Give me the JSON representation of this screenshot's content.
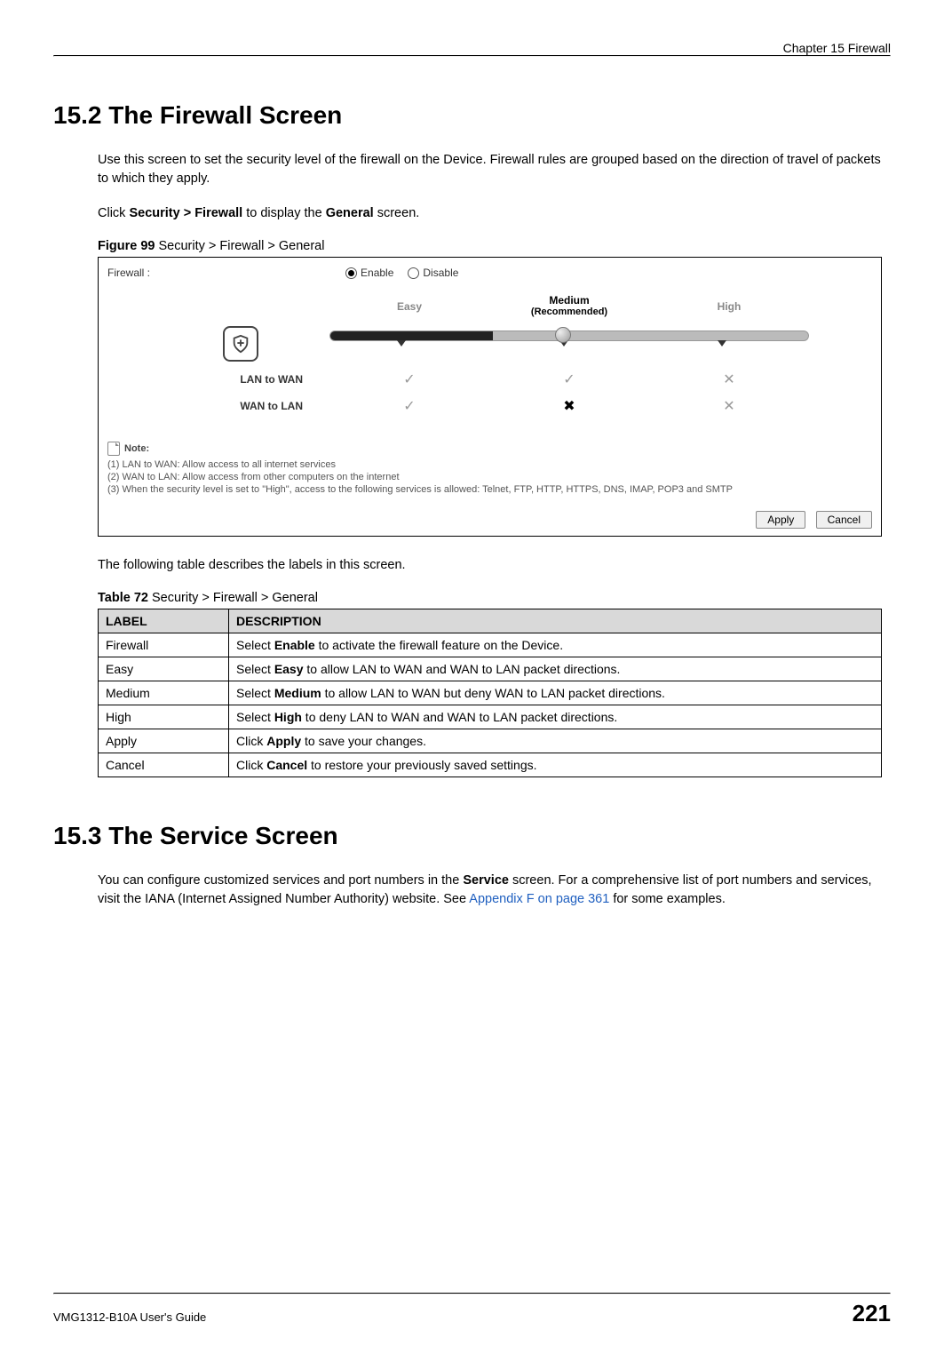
{
  "header": {
    "chapter": "Chapter 15 Firewall"
  },
  "section_15_2": {
    "title": "15.2  The Firewall Screen",
    "para1": "Use this screen to set the security level of the firewall on the Device. Firewall rules are grouped based on the direction of travel of packets to which they apply.",
    "para2_pre": "Click ",
    "para2_bold1": "Security > Firewall",
    "para2_mid": " to display the ",
    "para2_bold2": "General",
    "para2_post": " screen.",
    "figure_caption_strong": "Figure 99",
    "figure_caption_rest": "   Security > Firewall > General",
    "after_figure": "The following table describes the labels in this screen.",
    "table_caption_strong": "Table 72",
    "table_caption_rest": "   Security > Firewall > General"
  },
  "figure": {
    "firewall_label": "Firewall :",
    "enable": "Enable",
    "disable": "Disable",
    "easy": "Easy",
    "medium": "Medium",
    "recommended": "(Recommended)",
    "high": "High",
    "lan_to_wan": "LAN to WAN",
    "wan_to_lan": "WAN to LAN",
    "note_title": "Note:",
    "note1": "(1) LAN to WAN: Allow access to all internet services",
    "note2": "(2) WAN to LAN: Allow access from other computers on the internet",
    "note3": "(3) When the security level is set to \"High\", access to the following services is allowed: Telnet, FTP, HTTP, HTTPS, DNS, IMAP, POP3 and SMTP",
    "apply_btn": "Apply",
    "cancel_btn": "Cancel"
  },
  "table72": {
    "head_label": "LABEL",
    "head_desc": "DESCRIPTION",
    "rows": [
      {
        "label": "Firewall",
        "pre": "Select ",
        "bold": "Enable",
        "post": " to activate the firewall feature on the Device."
      },
      {
        "label": "Easy",
        "pre": "Select ",
        "bold": "Easy",
        "post": " to allow LAN to WAN and WAN to LAN packet directions."
      },
      {
        "label": "Medium",
        "pre": "Select ",
        "bold": "Medium",
        "post": " to allow LAN to WAN but deny WAN to LAN packet directions."
      },
      {
        "label": "High",
        "pre": "Select ",
        "bold": "High",
        "post": " to deny LAN to WAN and WAN to LAN packet directions."
      },
      {
        "label": "Apply",
        "pre": "Click ",
        "bold": "Apply",
        "post": " to save your changes."
      },
      {
        "label": "Cancel",
        "pre": "Click ",
        "bold": "Cancel",
        "post": " to restore your previously saved settings."
      }
    ]
  },
  "section_15_3": {
    "title": "15.3  The Service Screen",
    "para_pre": "You can configure customized services and port numbers in the ",
    "para_bold": "Service",
    "para_mid": " screen. For a comprehensive list of port numbers and services, visit the IANA (Internet Assigned Number Authority) website. See ",
    "para_link": "Appendix F on page 361",
    "para_post": " for some examples."
  },
  "footer": {
    "guide": "VMG1312-B10A User's Guide",
    "page": "221"
  }
}
